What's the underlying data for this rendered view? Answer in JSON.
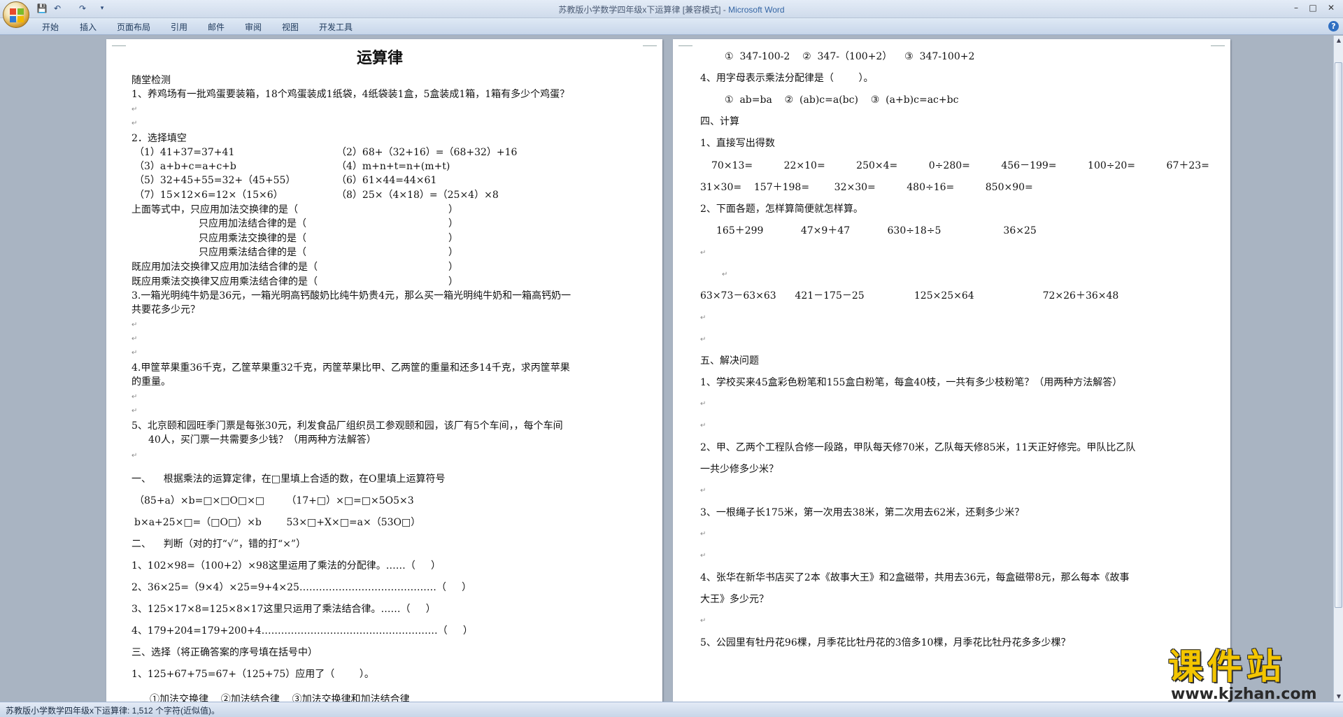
{
  "window": {
    "title": "苏教版小学数学四年级x下运算律 [兼容模式] - ",
    "app_name": "Microsoft Word"
  },
  "ribbon": {
    "tabs": [
      "开始",
      "插入",
      "页面布局",
      "引用",
      "邮件",
      "审阅",
      "视图",
      "开发工具"
    ]
  },
  "left_page": [
    {
      "text": "运算律",
      "style": "title"
    },
    {
      "text": "随堂检测"
    },
    {
      "text": "1、养鸡场有一批鸡蛋要装箱，18个鸡蛋装成1纸袋，4纸袋装1盒，5盒装成1箱，1箱有多少个鸡蛋？"
    },
    {
      "text": ""
    },
    {
      "text": ""
    },
    {
      "text": "2．选择填空"
    },
    {
      "text": "（1）41+37=37+41"
    },
    {
      "text": "（2）68+（32+16）=（68+32）+16"
    },
    {
      "text": "（3）a+b+c=a+c+b"
    },
    {
      "text": "（4）m+n+t=n+(m+t)"
    },
    {
      "text": "（5）32+45+55=32+（45+55）"
    },
    {
      "text": "（6）61×44=44×61"
    },
    {
      "text": "（7）15×12×6=12×（15×6）"
    },
    {
      "text": "（8）25×（4×18）=（25×4）×8"
    },
    {
      "text": "上面等式中，只应用加法交换律的是（"
    },
    {
      "text": "只应用加法结合律的是（"
    },
    {
      "text": "只应用乘法交换律的是（"
    },
    {
      "text": "只应用乘法结合律的是（"
    },
    {
      "text": "既应用加法交换律又应用加法结合律的是（"
    },
    {
      "text": "既应用乘法交换律又应用乘法结合律的是（"
    },
    {
      "text": "3.一箱光明纯牛奶是36元，一箱光明高钙酸奶比纯牛奶贵4元，那么买一箱光明纯牛奶和一箱高钙奶一"
    },
    {
      "text": "共要花多少元？"
    },
    {
      "text": "4.甲筐苹果重36千克，乙筐苹果重32千克，丙筐苹果比甲、乙两筐的重量和还多14千克，求丙筐苹果"
    },
    {
      "text": "的重量。"
    },
    {
      "text": "5、北京颐和园旺季门票是每张30元，利发食品厂组织员工参观颐和园，该厂有5个车间，，每个车间"
    },
    {
      "text": "40人，买门票一共需要多少钱？（用两种方法解答）"
    },
    {
      "text": "一、    根据乘法的运算定律，在□里填上合适的数，在O里填上运算符号"
    },
    {
      "text": "（85+a）×b=□×□O□×□       （17+□）×□=□×5O5×3"
    },
    {
      "text": "b×a+25×□=（□O□）×b        53×□+X×□=a×（53O□）"
    },
    {
      "text": "二、    判断（对的打“√”，错的打“×”）"
    },
    {
      "text": "1、102×98=（100+2）×98这里运用了乘法的分配律。……（     ）"
    },
    {
      "text": "2、36×25=（9×4）×25=9+4×25……………………………………（     ）"
    },
    {
      "text": "3、125×17×8=125×8×17这里只运用了乘法结合律。……（     ）"
    },
    {
      "text": "4、179+204=179+200+4………………………………………………（     ）"
    },
    {
      "text": "三、选择（将正确答案的序号填在括号中）"
    },
    {
      "text": "1、125+67+75=67+（125+75）应用了（        ）。"
    },
    {
      "text": "①加法交换律    ②加法结合律    ③加法交换律和加法结合律"
    }
  ],
  "right_page": [
    {
      "text": "①  347-100-2    ②  347-（100+2）    ③  347-100+2"
    },
    {
      "text": "4、用字母表示乘法分配律是（        ）。"
    },
    {
      "text": "①  ab=ba    ②  (ab)c=a(bc)    ③  (a+b)c=ac+bc"
    },
    {
      "text": "四、计算"
    },
    {
      "text": "1、直接写出得数"
    },
    {
      "text": "70×13=          22×10=          250×4=          0÷280=          456－199=          100÷20=          67＋23="
    },
    {
      "text": "31×30=    157＋198=        32×30=          480÷16=          850×90="
    },
    {
      "text": "2、下面各题，怎样算简便就怎样算。"
    },
    {
      "text": "165＋299            47×9＋47            630÷18÷5                    36×25"
    },
    {
      "text": "63×73－63×63      421－175－25                125×25×64                      72×26＋36×48"
    },
    {
      "text": "五、解决问题"
    },
    {
      "text": "1、学校买来45盒彩色粉笔和155盒白粉笔，每盒40枝，一共有多少枝粉笔？（用两种方法解答）"
    },
    {
      "text": "2、甲、乙两个工程队合修一段路，甲队每天修70米，乙队每天修85米，11天正好修完。甲队比乙队"
    },
    {
      "text": "一共少修多少米？"
    },
    {
      "text": "3、一根绳子长175米，第一次用去38米，第二次用去62米，还剩多少米？"
    },
    {
      "text": "4、张华在新华书店买了2本《故事大王》和2盒磁带，共用去36元，每盒磁带8元，那么每本《故事"
    },
    {
      "text": "大王》多少元？"
    },
    {
      "text": "5、公园里有牡丹花96棵，月季花比牡丹花的3倍多10棵，月季花比牡丹花多多少棵？"
    }
  ],
  "status": {
    "text": "苏教版小学数学四年级x下运算律: 1,512 个字符(近似值)。"
  },
  "watermark": {
    "title": "课件站",
    "url": "www.kjzhan.com"
  },
  "icons": [
    "office-button",
    "save-icon",
    "undo-icon",
    "redo-icon",
    "customize-icon",
    "minimize-icon",
    "maximize-icon",
    "close-icon",
    "help-icon"
  ]
}
